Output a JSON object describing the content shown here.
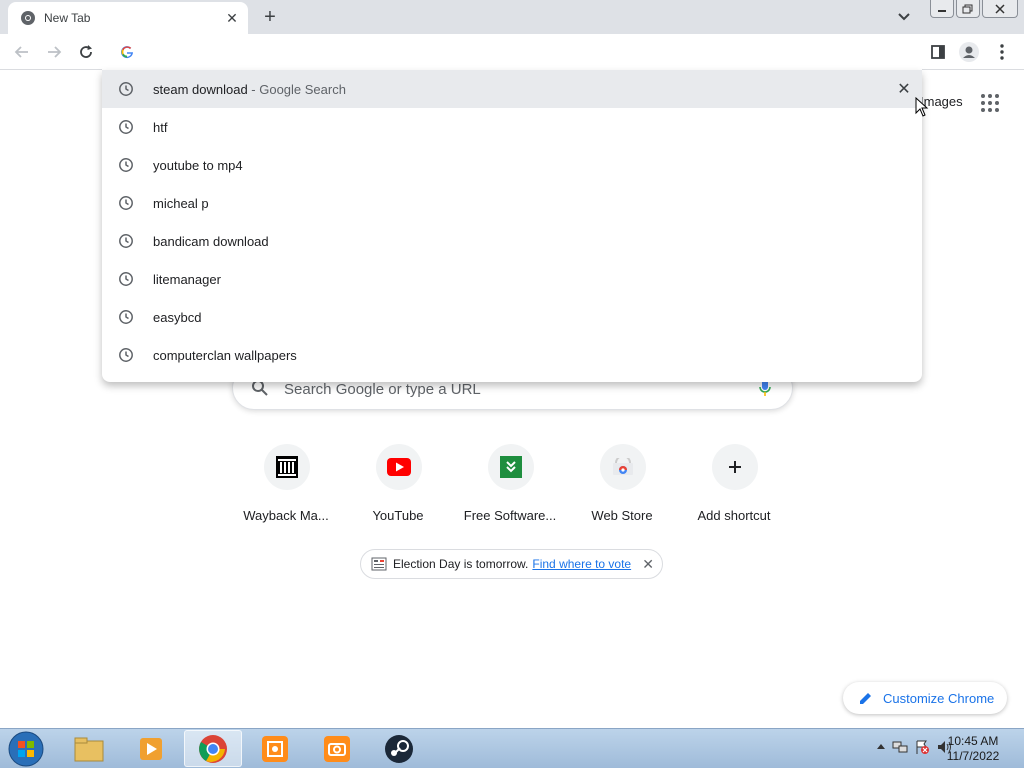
{
  "browser": {
    "tab_title": "New Tab",
    "omnibox_value": ""
  },
  "suggestions": [
    {
      "text": "steam download",
      "sub": " - Google Search"
    },
    {
      "text": "htf",
      "sub": ""
    },
    {
      "text": "youtube to mp4",
      "sub": ""
    },
    {
      "text": "micheal p",
      "sub": ""
    },
    {
      "text": "bandicam download",
      "sub": ""
    },
    {
      "text": "litemanager",
      "sub": ""
    },
    {
      "text": "easybcd",
      "sub": ""
    },
    {
      "text": "computerclan wallpapers",
      "sub": ""
    }
  ],
  "ntp": {
    "images_link": "Images",
    "search_placeholder": "Search Google or type a URL",
    "shortcuts": [
      {
        "label": "Wayback Ma...",
        "icon": "wayback-icon"
      },
      {
        "label": "YouTube",
        "icon": "youtube-icon"
      },
      {
        "label": "Free Software...",
        "icon": "free-software-icon"
      },
      {
        "label": "Web Store",
        "icon": "web-store-icon"
      },
      {
        "label": "Add shortcut",
        "icon": "plus-icon"
      }
    ],
    "promo_text": "Election Day is tomorrow.",
    "promo_link": "Find where to vote",
    "customize_label": "Customize Chrome"
  },
  "taskbar": {
    "time": "10:45 AM",
    "date": "11/7/2022"
  },
  "colors": {
    "accent": "#1a73e8",
    "tabstrip": "#dee1e6",
    "youtube_red": "#ff0000",
    "green": "#1e8e3e"
  }
}
